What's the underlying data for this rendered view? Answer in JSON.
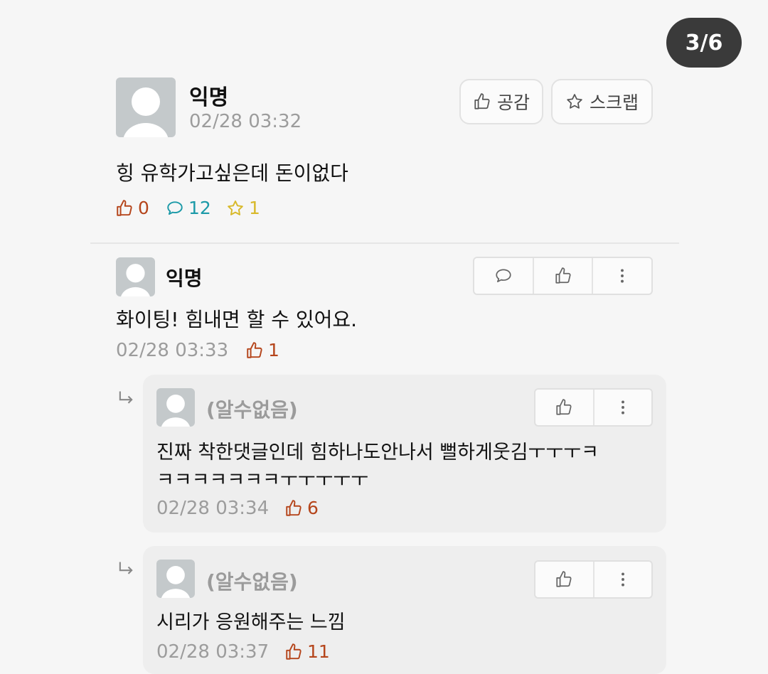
{
  "pager": {
    "label": "3/6"
  },
  "post": {
    "author": "익명",
    "time": "02/28 03:32",
    "content": "힝 유학가고싶은데 돈이없다",
    "buttons": {
      "like_label": "공감",
      "scrap_label": "스크랩"
    },
    "stats": {
      "likes": "0",
      "comments": "12",
      "scraps": "1"
    },
    "colors": {
      "likes": "#b5451b",
      "comments": "#1c9aa8",
      "scraps": "#d8b92a"
    }
  },
  "comments": [
    {
      "author": "익명",
      "content": "화이팅! 힘내면 할 수 있어요.",
      "time": "02/28 03:33",
      "likes": "1",
      "replies": [
        {
          "author": "(알수없음)",
          "content_line1": "진짜 착한댓글인데 힘하나도안나서 뻘하게웃김ㅜㅜㅜㅋ",
          "content_line2": "ㅋㅋㅋㅋㅋㅋㅋㅜㅜㅜㅜㅜ",
          "time": "02/28 03:34",
          "likes": "6"
        },
        {
          "author": "(알수없음)",
          "content_line1": "시리가 응원해주는 느낌",
          "time": "02/28 03:37",
          "likes": "11"
        }
      ]
    }
  ]
}
